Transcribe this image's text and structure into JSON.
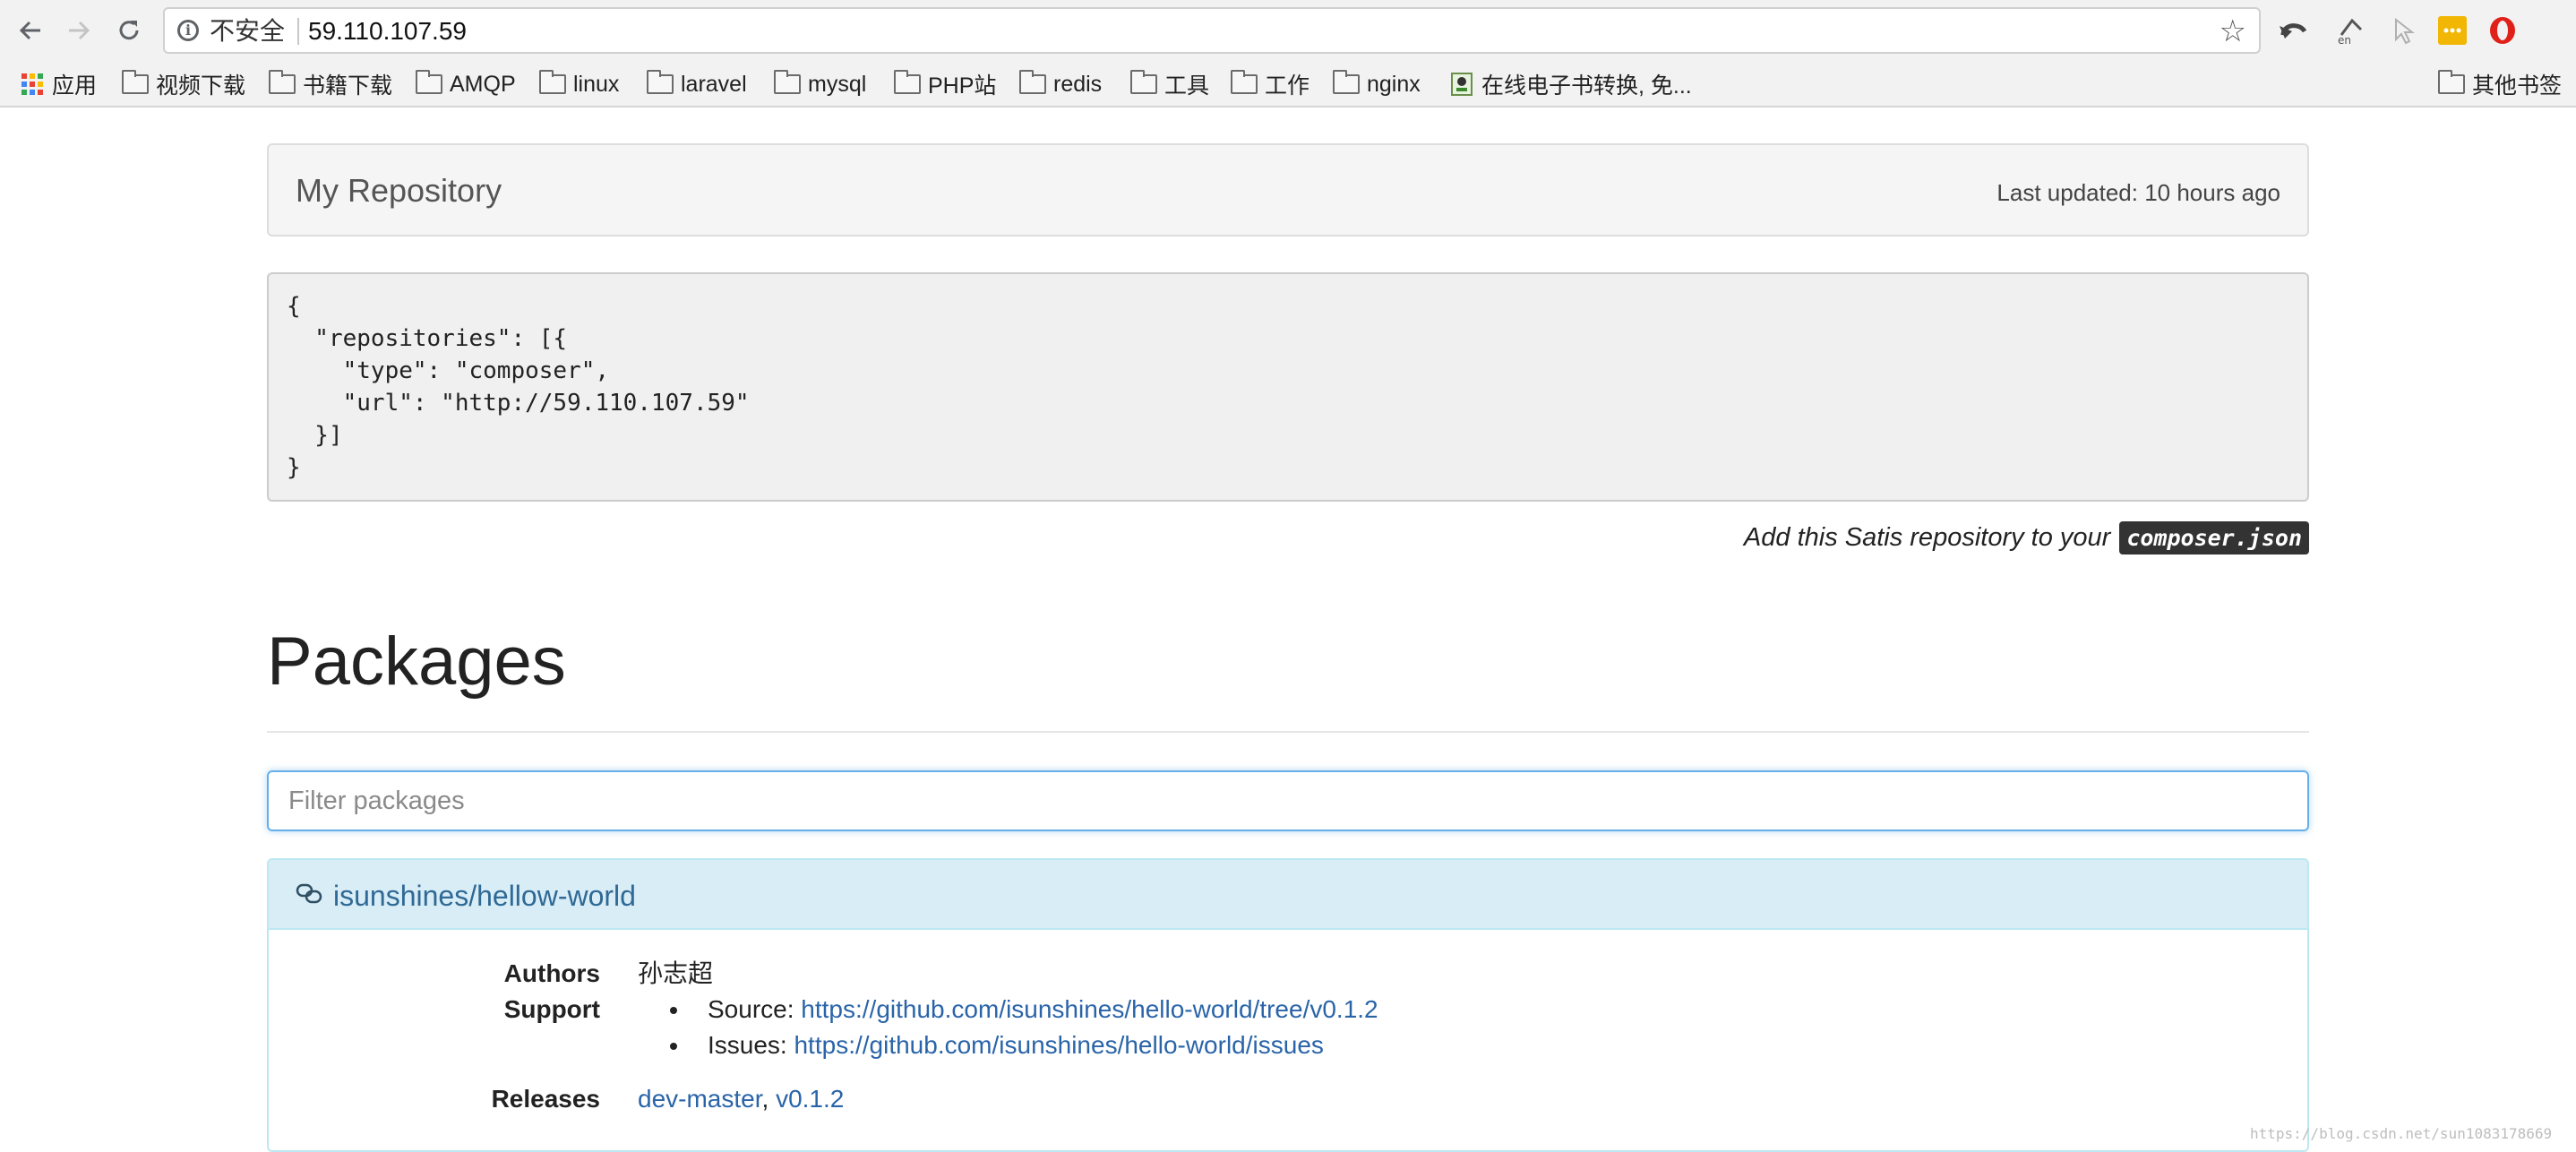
{
  "browser": {
    "security_label": "不安全",
    "url": "59.110.107.59"
  },
  "bookmarks": [
    {
      "label": "应用",
      "icon": "apps-grid-icon"
    },
    {
      "label": "视频下载",
      "icon": "folder-icon"
    },
    {
      "label": "书籍下载",
      "icon": "folder-icon"
    },
    {
      "label": "AMQP",
      "icon": "folder-icon"
    },
    {
      "label": "linux",
      "icon": "folder-icon"
    },
    {
      "label": "laravel",
      "icon": "folder-icon"
    },
    {
      "label": "mysql",
      "icon": "folder-icon"
    },
    {
      "label": "PHP站",
      "icon": "folder-icon"
    },
    {
      "label": "redis",
      "icon": "folder-icon"
    },
    {
      "label": "工具",
      "icon": "folder-icon"
    },
    {
      "label": "工作",
      "icon": "folder-icon"
    },
    {
      "label": "nginx",
      "icon": "folder-icon"
    },
    {
      "label": "在线电子书转换, 免...",
      "icon": "page-favicon-icon"
    },
    {
      "label": "其他书签",
      "icon": "folder-icon"
    }
  ],
  "header": {
    "title": "My Repository",
    "last_updated": "Last updated: 10 hours ago"
  },
  "config_snippet": "{\n  \"repositories\": [{\n    \"type\": \"composer\",\n    \"url\": \"http://59.110.107.59\"\n  }]\n}",
  "add_note": {
    "text": "Add this Satis repository to your",
    "filename": "composer.json"
  },
  "packages_heading": "Packages",
  "filter": {
    "placeholder": "Filter packages"
  },
  "package": {
    "name": "isunshines/hellow-world",
    "authors_label": "Authors",
    "authors_value": "孙志超",
    "support_label": "Support",
    "source_label": "Source:",
    "source_url": "https://github.com/isunshines/hello-world/tree/v0.1.2",
    "issues_label": "Issues:",
    "issues_url": "https://github.com/isunshines/hello-world/issues",
    "releases_label": "Releases",
    "releases": [
      "dev-master",
      "v0.1.2"
    ],
    "release_separator": ","
  },
  "watermark": "https://blog.csdn.net/sun1083178669",
  "colors": {
    "link": "#2a64a8",
    "panel_heading": "#d9edf7",
    "panel_border": "#bce8f1",
    "focus_border": "#66afe9"
  }
}
